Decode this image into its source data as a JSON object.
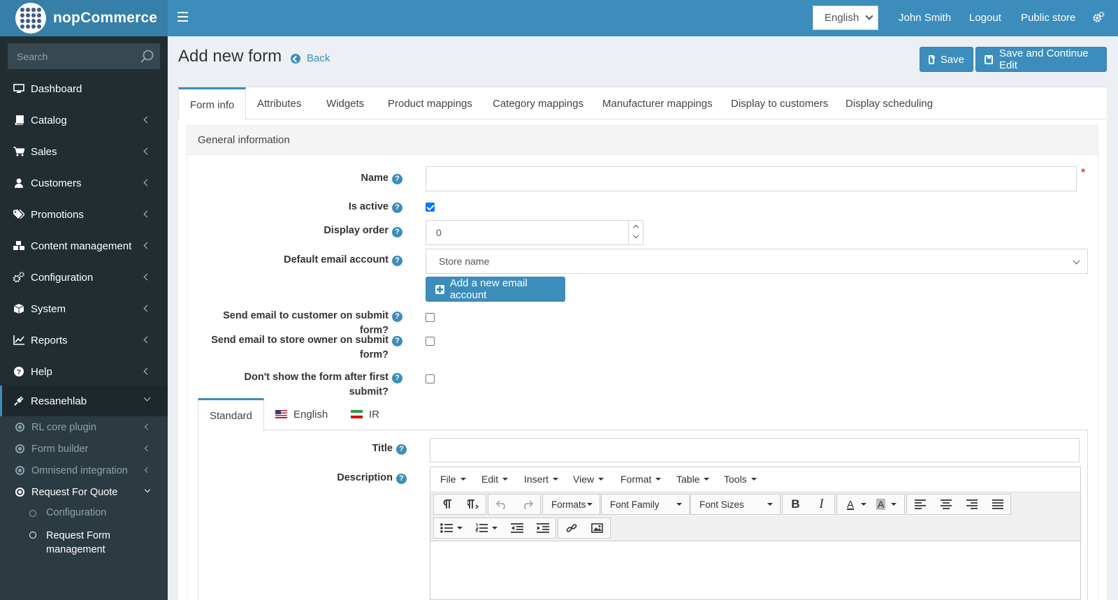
{
  "header": {
    "brand": "nopCommerce",
    "language": "English",
    "user": "John Smith",
    "logout": "Logout",
    "public_store": "Public store",
    "colors": {
      "header": "#3c8dbc",
      "sidebar": "#222d32",
      "accent": "#3c8dbc"
    }
  },
  "sidebar": {
    "search_placeholder": "Search",
    "items": [
      {
        "label": "Dashboard",
        "icon": "monitor-icon"
      },
      {
        "label": "Catalog",
        "icon": "book-icon"
      },
      {
        "label": "Sales",
        "icon": "cart-icon"
      },
      {
        "label": "Customers",
        "icon": "user-icon"
      },
      {
        "label": "Promotions",
        "icon": "tags-icon"
      },
      {
        "label": "Content management",
        "icon": "cubes-icon"
      },
      {
        "label": "Configuration",
        "icon": "gears-icon"
      },
      {
        "label": "System",
        "icon": "cube-icon"
      },
      {
        "label": "Reports",
        "icon": "line-chart-icon"
      },
      {
        "label": "Help",
        "icon": "question-icon"
      },
      {
        "label": "Resanehlab",
        "icon": "plug-icon"
      }
    ],
    "sub_items": [
      {
        "label": "RL core plugin"
      },
      {
        "label": "Form builder"
      },
      {
        "label": "Omnisend integration"
      },
      {
        "label": "Request For Quote"
      }
    ],
    "sub2_items": [
      {
        "label": "Configuration"
      },
      {
        "label": "Request Form management"
      }
    ]
  },
  "page": {
    "title": "Add new form",
    "back": "Back",
    "save": "Save",
    "save_continue": "Save and Continue Edit"
  },
  "tabs": [
    "Form info",
    "Attributes",
    "Widgets",
    "Product mappings",
    "Category mappings",
    "Manufacturer mappings",
    "Display to customers",
    "Display scheduling"
  ],
  "general": {
    "heading": "General information",
    "name_label": "Name",
    "name_value": "",
    "required_mark": "*",
    "is_active_label": "Is active",
    "is_active": true,
    "display_order_label": "Display order",
    "display_order_value": "0",
    "email_account_label": "Default email account",
    "email_account_value": "Store name",
    "add_email_account": "Add a new email account",
    "send_customer_label": "Send email to customer on submit form?",
    "send_owner_label": "Send email to store owner on submit form?",
    "dont_show_label": "Don't show the form after first submit?",
    "help": "?"
  },
  "lang_tabs": [
    "Standard",
    "English",
    "IR"
  ],
  "localized": {
    "title_label": "Title",
    "description_label": "Description"
  },
  "editor": {
    "menus": [
      "File",
      "Edit",
      "Insert",
      "View",
      "Format",
      "Table",
      "Tools"
    ],
    "formats": "Formats",
    "font_family": "Font Family",
    "font_sizes": "Font Sizes",
    "bold": "B",
    "italic": "I",
    "text_color": "A",
    "bg_color": "A"
  }
}
